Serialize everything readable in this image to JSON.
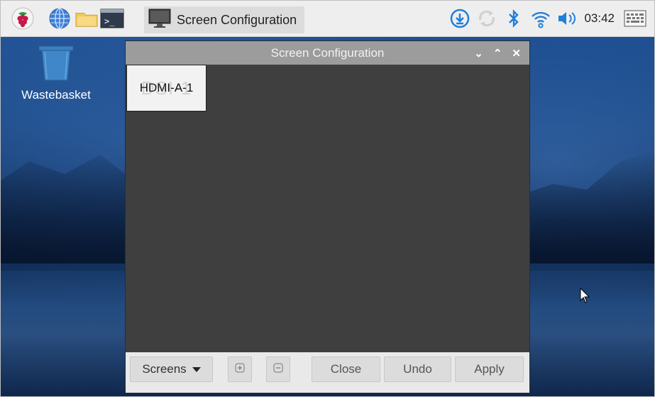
{
  "taskbar": {
    "icons": [
      "raspberry-menu-icon",
      "web-browser-icon",
      "file-manager-icon",
      "terminal-icon"
    ],
    "active_task": {
      "icon": "monitor-icon",
      "label": "Screen Configuration"
    },
    "tray": {
      "icons": [
        "updates-download-icon",
        "sync-icon",
        "bluetooth-icon",
        "wifi-icon",
        "volume-icon"
      ],
      "clock": "03:42",
      "keyboard_icon": "virtual-keyboard-icon"
    }
  },
  "desktop": {
    "wastebasket_label": "Wastebasket"
  },
  "window": {
    "title": "Screen Configuration",
    "controls": [
      "minimize",
      "maximize",
      "close"
    ],
    "monitor": {
      "name": "HDMI-A-1",
      "ghost_name": "DSI-1"
    },
    "buttons": {
      "screens": "Screens",
      "close": "Close",
      "undo": "Undo",
      "apply": "Apply"
    }
  },
  "colors": {
    "taskbar_bg": "#eeeeee",
    "accent_blue": "#1f7fd8",
    "window_bg": "#3f3f3f",
    "titlebar_bg": "#9c9c9c"
  }
}
